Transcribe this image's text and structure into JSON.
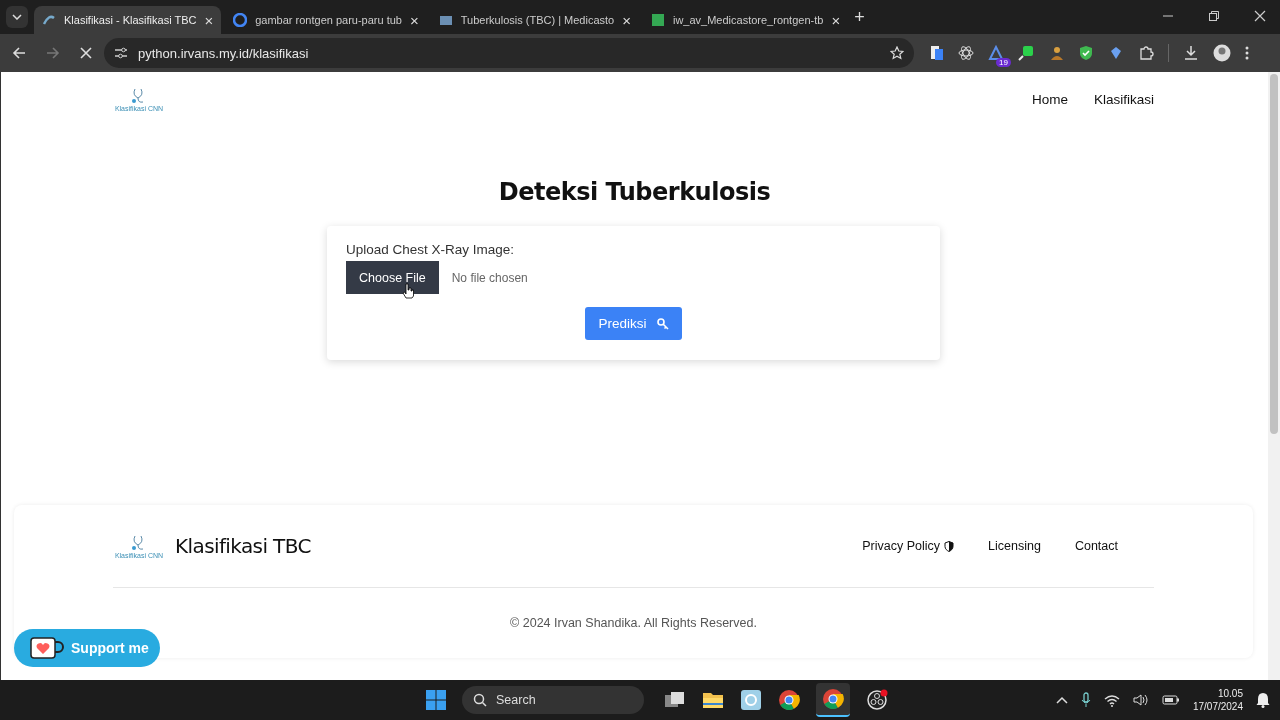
{
  "browser": {
    "tabs": [
      {
        "title": "Klasifikasi - Klasifikasi TBC",
        "selected": true,
        "close": "×"
      },
      {
        "title": "gambar rontgen paru-paru tub",
        "selected": false,
        "close": "×"
      },
      {
        "title": "Tuberkulosis (TBC) | Medicasto",
        "selected": false,
        "close": "×"
      },
      {
        "title": "iw_av_Medicastore_rontgen-tb",
        "selected": false,
        "close": "×"
      }
    ],
    "new_tab": "+",
    "url": "python.irvans.my.id/klasifikasi",
    "extension_badge": "19"
  },
  "header": {
    "logo_text": "Klasifikasi CNN",
    "nav": [
      {
        "label": "Home"
      },
      {
        "label": "Klasifikasi"
      }
    ]
  },
  "main": {
    "title": "Deteksi Tuberkulosis",
    "upload_label": "Upload Chest X-Ray Image:",
    "choose_button": "Choose File",
    "file_status": "No file chosen",
    "submit_button": "Prediksi"
  },
  "footer": {
    "logo_text": "Klasifikasi CNN",
    "brand": "Klasifikasi TBC",
    "links": [
      {
        "label": "Privacy Policy",
        "kind": "shield"
      },
      {
        "label": "Licensing",
        "kind": "plain"
      },
      {
        "label": "Contact",
        "kind": "plain"
      }
    ],
    "copyright": "© 2024 Irvan Shandika. All Rights Reserved."
  },
  "support_button": "Support me",
  "taskbar": {
    "search_placeholder": "Search",
    "time": "10.05",
    "date": "17/07/2024"
  }
}
